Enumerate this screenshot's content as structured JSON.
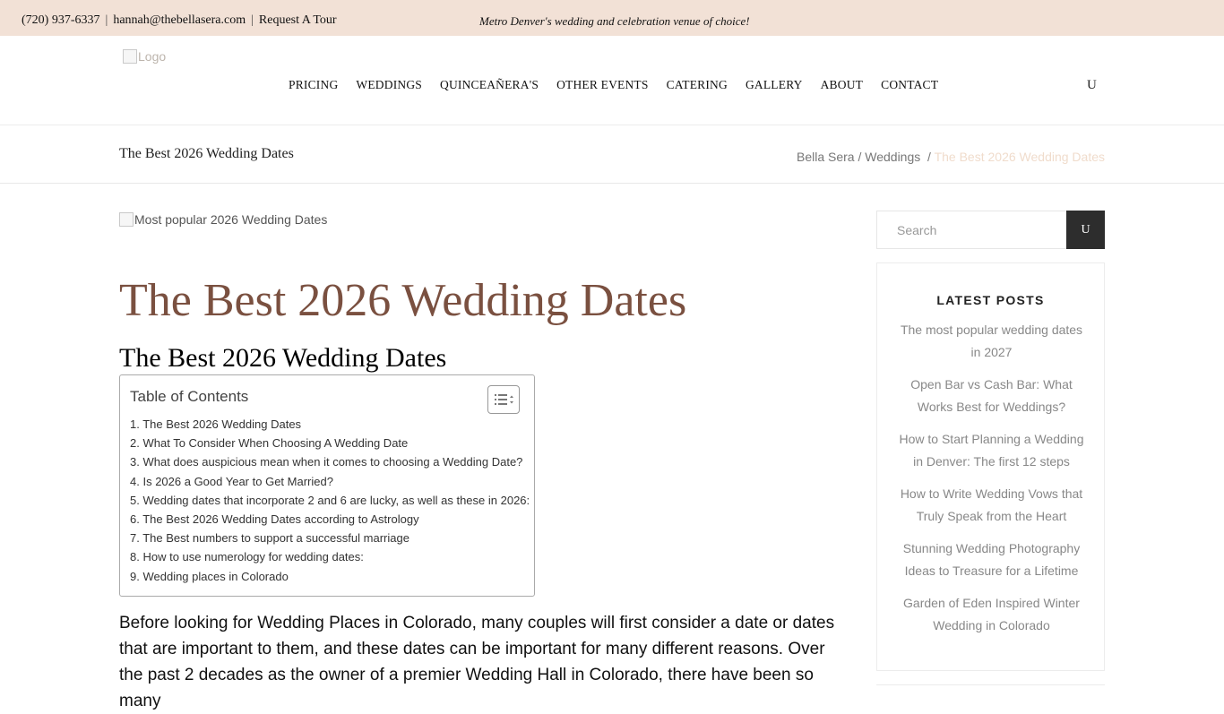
{
  "topbar": {
    "phone": "(720) 937-6337",
    "separator": "|",
    "email": "hannah@thebellasera.com",
    "tour_link": "Request A Tour",
    "tagline": "Metro Denver's wedding and celebration venue of choice!"
  },
  "header": {
    "logo_alt": "Logo",
    "nav": [
      "PRICING",
      "WEDDINGS",
      "QUINCEAÑERA'S",
      "OTHER EVENTS",
      "CATERING",
      "GALLERY",
      "ABOUT",
      "CONTACT"
    ],
    "icon_glyph": "U"
  },
  "titlebar": {
    "title": "The Best 2026 Wedding Dates",
    "breadcrumb": {
      "home": "Bella Sera",
      "sep1": "/",
      "category": "Weddings",
      "sep2": "/",
      "current": "The Best 2026 Wedding Dates"
    }
  },
  "main": {
    "featured_image_alt": "Most popular 2026 Wedding Dates",
    "post_title": "The Best 2026 Wedding Dates",
    "h2": "The Best 2026 Wedding Dates",
    "toc": {
      "title": "Table of Contents",
      "items": [
        {
          "num": "1.",
          "label": "The Best 2026 Wedding Dates"
        },
        {
          "num": "2.",
          "label": "What To Consider When Choosing A Wedding Date"
        },
        {
          "num": "3.",
          "label": "What does auspicious mean when it comes to choosing a Wedding Date?"
        },
        {
          "num": "4.",
          "label": "Is 2026 a Good Year to Get Married?"
        },
        {
          "num": "5.",
          "label": "Wedding dates that incorporate 2 and 6 are lucky, as well as these in 2026:"
        },
        {
          "num": "6.",
          "label": "The Best 2026 Wedding Dates according to Astrology"
        },
        {
          "num": "7.",
          "label": "The Best numbers to support a successful marriage"
        },
        {
          "num": "8.",
          "label": "How to use numerology for wedding dates:"
        },
        {
          "num": "9.",
          "label": "Wedding places in Colorado"
        }
      ]
    },
    "body_text": "Before looking for Wedding Places in Colorado, many couples will first consider a date or dates that are important to them, and these dates can be important for many different reasons. Over the past 2 decades as the owner of a premier Wedding Hall in Colorado, there have been so many"
  },
  "sidebar": {
    "search_placeholder": "Search",
    "search_button_glyph": "U",
    "latest_posts_title": "LATEST POSTS",
    "posts": [
      "The most popular wedding dates in 2027",
      "Open Bar vs Cash Bar: What Works Best for Weddings?",
      "How to Start Planning a Wedding in Denver: The first 12 steps",
      "How to Write Wedding Vows that Truly Speak from the Heart",
      "Stunning Wedding Photography Ideas to Treasure for a Lifetime",
      "Garden of Eden Inspired Winter Wedding in Colorado"
    ]
  },
  "colors": {
    "topbar_bg": "#f2e1d6",
    "title_accent": "#7a5040",
    "breadcrumb_current": "#f0dccc",
    "search_button_bg": "#2d2d2d"
  }
}
